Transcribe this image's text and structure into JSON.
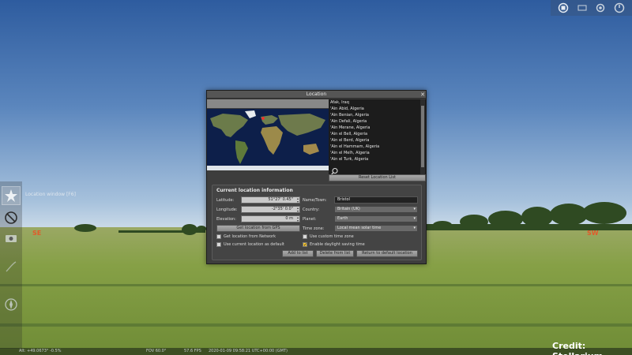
{
  "toolbar": {
    "icons": [
      "window-icon",
      "minimize-icon",
      "settings-icon",
      "exit-icon"
    ]
  },
  "left_bar": {
    "tooltip": "Location window  [F6]",
    "icons": [
      "location-icon",
      "lens-icon",
      "camera-icon",
      "feather-icon",
      "compass-icon"
    ]
  },
  "cardinals": {
    "left": "SE",
    "right": "SW"
  },
  "status": {
    "coords": "Alt: +49.0673°  -0.5%",
    "fov": "FOV 60.0°",
    "fps": "57.6 FPS",
    "datetime": "2020-01-09 09:58:21 UTC+00:00 (GMT)"
  },
  "credit": "Credit: Stellarium",
  "window": {
    "title": "Location",
    "close": "✕",
    "cities": [
      "Afak, Iraq",
      "'Ain Abid, Algeria",
      "'Ain Benian, Algeria",
      "'Ain Defali, Algeria",
      "'Ain Merane, Algeria",
      "'Ain el Bell, Algeria",
      "'Ain el Berd, Algeria",
      "'Ain el Hammam, Algeria",
      "'Ain el Melh, Algeria",
      "'Ain el Turk, Algeria"
    ],
    "search_value": "",
    "reset_label": "Reset Location List",
    "current_heading": "Current location information",
    "latitude_label": "Latitude:",
    "latitude_value": "51°27' 0.45\"",
    "longitude_label": "Longitude:",
    "longitude_value": "-2°35' 0.0\"",
    "elevation_label": "Elevation:",
    "elevation_value": "0 m",
    "gps_button": "Get location from GPS",
    "network_label": "Get location from Network",
    "default_label": "Use current location as default",
    "name_label": "Name/Town:",
    "name_value": "Bristol",
    "country_label": "Country:",
    "country_value": "Britain (UK)",
    "planet_label": "Planet:",
    "planet_value": "Earth",
    "timezone_label": "Time zone:",
    "timezone_value": "Local mean solar time",
    "custom_tz_label": "Use custom time zone",
    "dst_label": "Enable daylight saving time",
    "add_button": "Add to list",
    "delete_button": "Delete from list",
    "return_button": "Return to default location"
  },
  "colors": {
    "sky_top": "#2f5fa3",
    "sky_horizon": "#c8d8e6",
    "grass": "#7f9a3f",
    "label_orange": "#e25a2a"
  }
}
